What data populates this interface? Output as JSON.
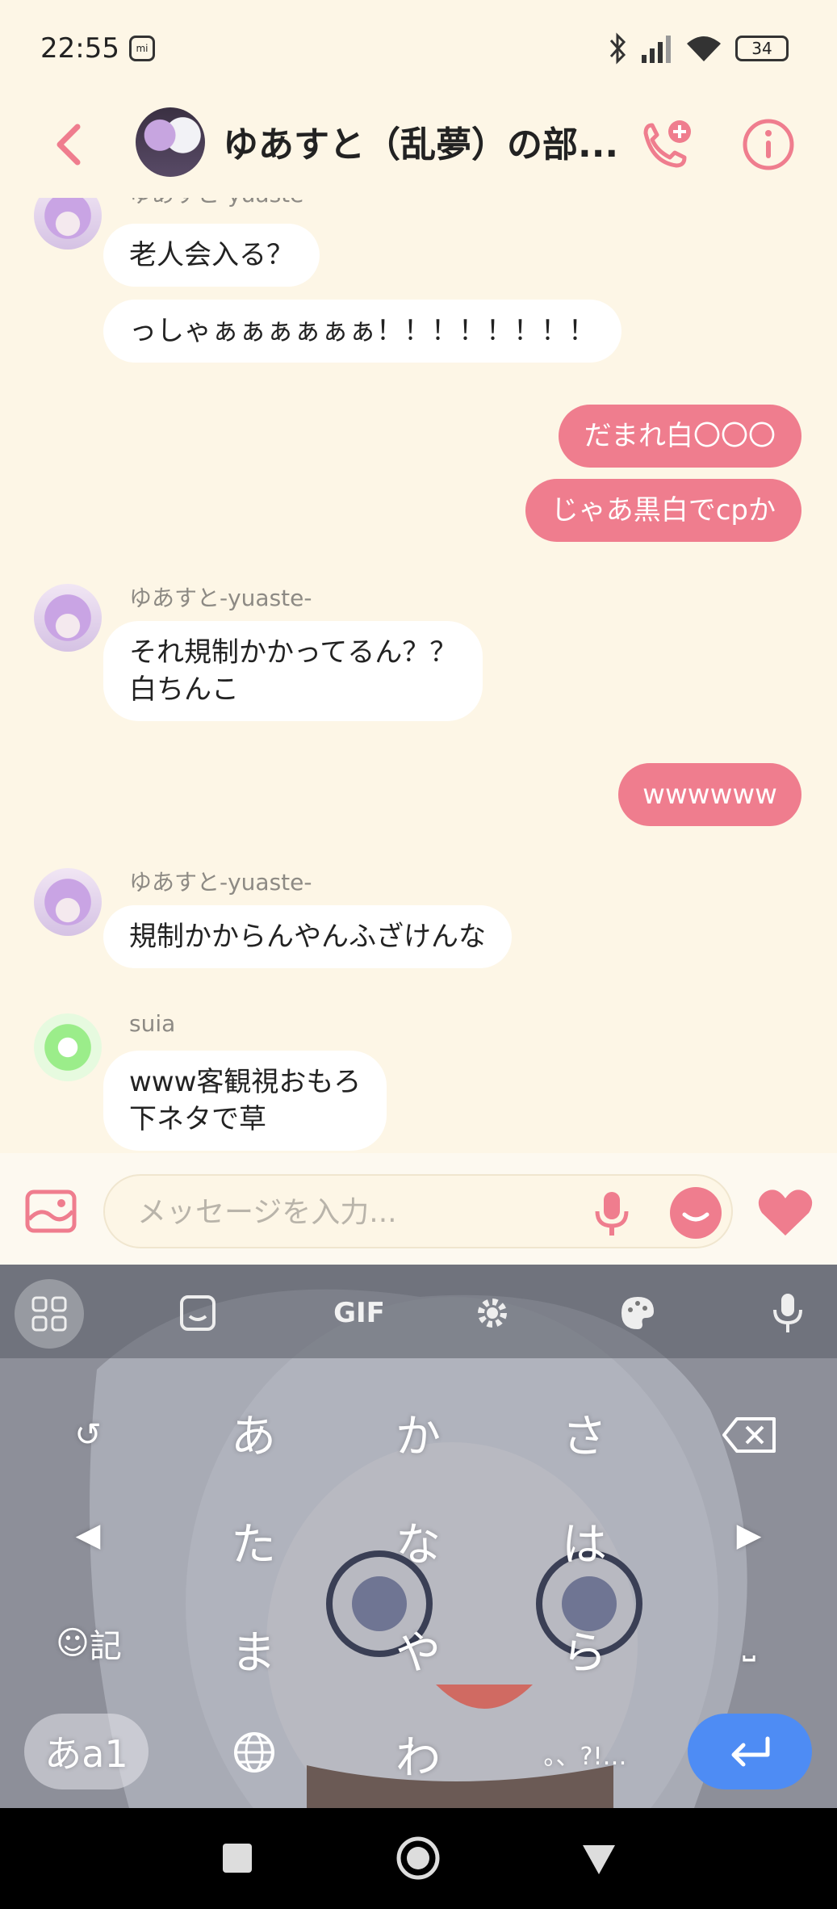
{
  "status": {
    "time": "22:55",
    "battery": "34"
  },
  "header": {
    "title": "ゆあすと（乱夢）の部..."
  },
  "messages": [
    {
      "sender": "ゆあすと-yuaste-",
      "text": "老人会入る？"
    },
    {
      "text": "っしゃぁぁぁぁぁぁ！！！！！！！！"
    },
    {
      "text": "だまれ白〇〇〇"
    },
    {
      "text": "じゃあ黒白でcpか"
    },
    {
      "sender": "ゆあすと-yuaste-",
      "text": "それ規制かかってるん？？\n白ちんこ"
    },
    {
      "text": "wwwwww"
    },
    {
      "sender": "ゆあすと-yuaste-",
      "text": "規制かからんやんふざけんな"
    },
    {
      "sender": "suia",
      "text": "www客観視おもろ\n下ネタで草"
    }
  ],
  "input": {
    "placeholder": "メッセージを入力..."
  },
  "keyboard": {
    "toolbar": {
      "gif": "GIF"
    },
    "keys": {
      "a": "あ",
      "ka": "か",
      "sa": "さ",
      "ta": "た",
      "na": "な",
      "ha": "は",
      "ma": "ま",
      "ya": "や",
      "ra": "ら",
      "wa": "わ",
      "emoji_kanji": "記",
      "lang": "あa1",
      "punct": "。、?!…",
      "undo": "↺",
      "left": "◀",
      "right": "▶",
      "space": "⎵"
    }
  },
  "colors": {
    "accent": "#ef7d8e",
    "background": "#fdf6e6",
    "enter": "#4e8cf4"
  }
}
